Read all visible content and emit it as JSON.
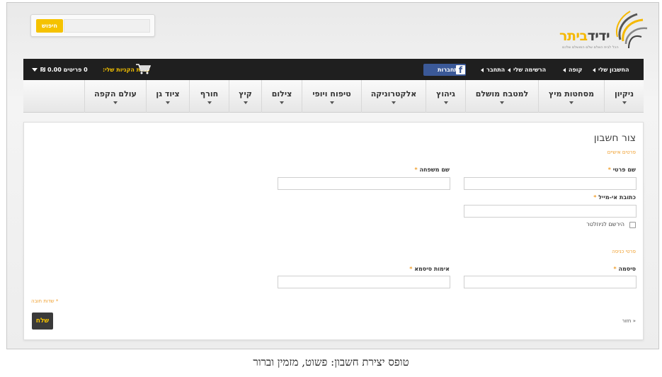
{
  "header": {
    "search_button": "חיפוש",
    "logo_main": "ידיד",
    "logo_accent": "ביתר",
    "logo_tagline": "הכל לבית השלם שלם המושלם שלכם"
  },
  "topbar": {
    "links": [
      "החשבון שלי",
      "קופה",
      "הרשימה שלי",
      "התחבר"
    ],
    "facebook_label": "התחברות",
    "cart_label": "עגלת הקניות שלי:",
    "cart_count": "0 פריטים 0.00 ₪"
  },
  "categories": [
    "ניקיון",
    "מסחטות מיץ",
    "למטבח מושלם",
    "גיהוץ",
    "אלקטרוניקה",
    "טיפוח ויופי",
    "צילום",
    "קיץ",
    "חורף",
    "ציוד גן",
    "עולם הקפה"
  ],
  "form": {
    "title": "צור חשבון",
    "personal_section": "פרטים אישיים",
    "first_name_label": "שם פרטי",
    "last_name_label": "שם משפחה",
    "email_label": "כתובת אי-מייל",
    "newsletter_label": "הירשם לניוזלטר",
    "login_section": "פרטי כניסה",
    "password_label": "סיסמה",
    "confirm_password_label": "אימות סיסמא",
    "required_note": "* שדות חובה",
    "back_link": "« חזור",
    "submit_label": "שלח",
    "required_mark": "*"
  },
  "caption": "טופס יצירת חשבון: פשוט, מזמין וברור",
  "colors": {
    "accent": "#f5c200",
    "topbar": "#1f1f1f",
    "facebook": "#3b5998",
    "section_orange": "#f0a030"
  }
}
